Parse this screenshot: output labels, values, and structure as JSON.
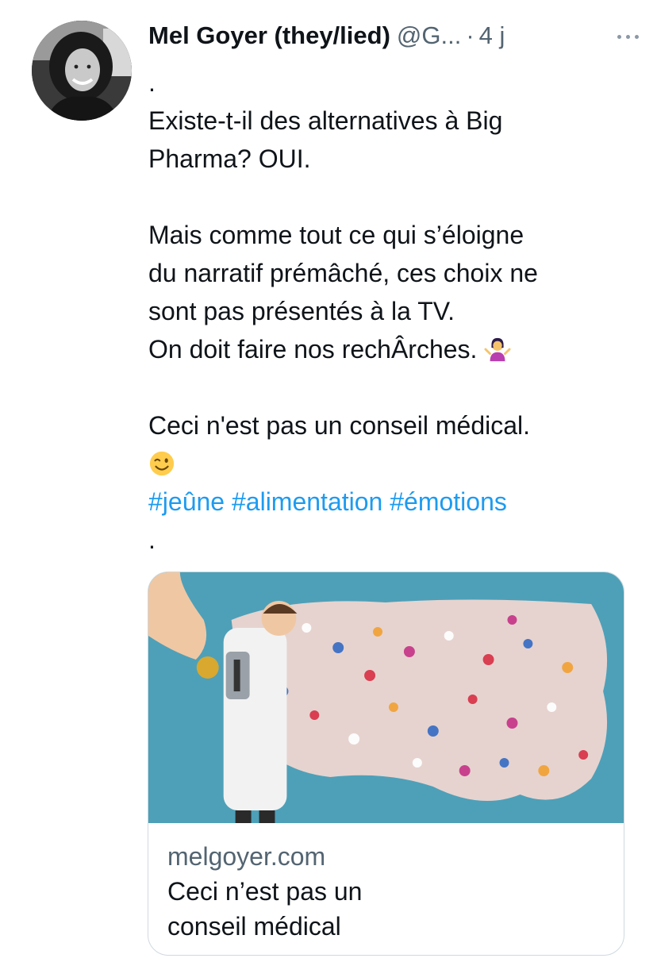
{
  "tweet": {
    "author_name": "Mel Goyer (they/lied)",
    "author_handle": "@G...",
    "separator": "·",
    "time": "4 j",
    "lines": [
      ".",
      "Existe-t-il des alternatives à Big",
      "Pharma? OUI.",
      "",
      "Mais comme tout ce qui s’éloigne",
      "du narratif prémâché, ces choix ne",
      "sont pas présentés à la TV.",
      "On doit faire nos rechÂrches."
    ],
    "disclaimer": "Ceci n'est pas un conseil médical.",
    "hashtags": [
      "#jeûne",
      "#alimentation",
      "#émotions"
    ],
    "closing_dot": "."
  },
  "emojis": {
    "shrug": "person-shrugging-icon",
    "wink": "winking-face-icon"
  },
  "card": {
    "domain": "melgoyer.com",
    "title_line1": "Ceci n’est pas un",
    "title_line2": "conseil médical"
  },
  "colors": {
    "link": "#1d9bf0",
    "secondary_text": "#536471",
    "image_background": "#4ea0b8"
  }
}
